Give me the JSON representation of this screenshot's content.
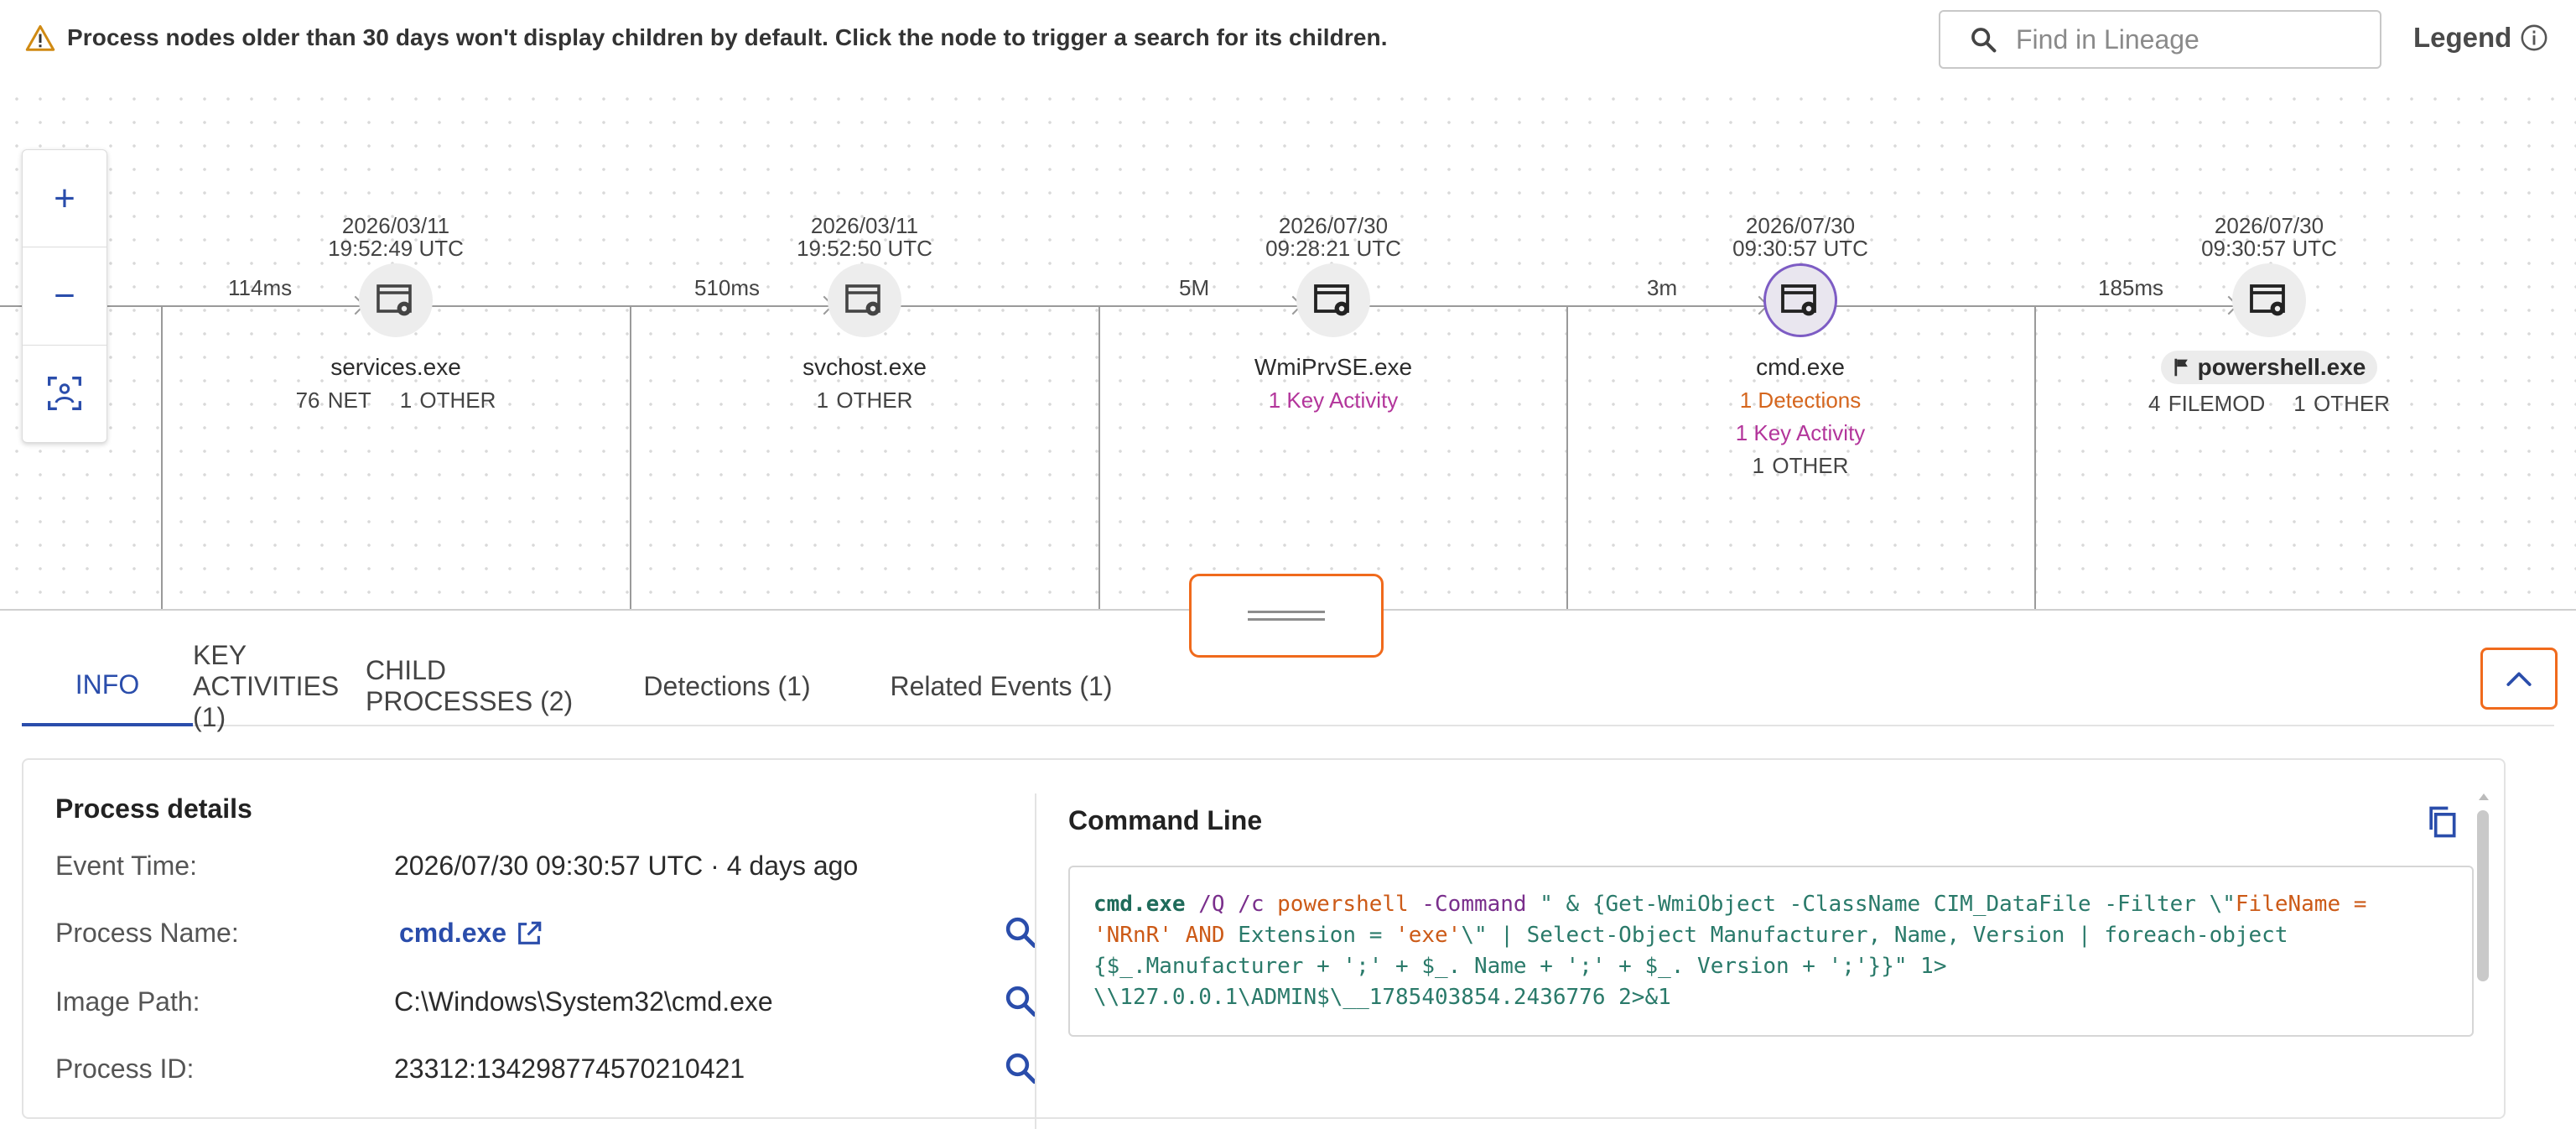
{
  "banner": {
    "text": "Process nodes older than 30 days won't display children by default. Click the node to trigger a search for its children."
  },
  "search": {
    "placeholder": "Find in Lineage"
  },
  "legend": {
    "label": "Legend"
  },
  "zoom": {
    "in": "+",
    "out": "−"
  },
  "durations": [
    "114ms",
    "510ms",
    "5M",
    "3m",
    "185ms"
  ],
  "nodes": [
    {
      "date": "2026/03/11",
      "time": "19:52:49 UTC",
      "name": "services.exe",
      "meta1": "76 NET",
      "meta2": "1 OTHER"
    },
    {
      "date": "2026/03/11",
      "time": "19:52:50 UTC",
      "name": "svchost.exe",
      "meta1": "1 OTHER"
    },
    {
      "date": "2026/07/30",
      "time": "09:28:21 UTC",
      "name": "WmiPrvSE.exe",
      "key": "1 Key Activity"
    },
    {
      "date": "2026/07/30",
      "time": "09:30:57 UTC",
      "name": "cmd.exe",
      "detections": "1 Detections",
      "key": "1 Key Activity",
      "meta1": "1 OTHER"
    },
    {
      "date": "2026/07/30",
      "time": "09:30:57 UTC",
      "name": "powershell.exe",
      "meta1": "4 FILEMOD",
      "meta2": "1 OTHER"
    }
  ],
  "tabs": [
    {
      "label": "INFO"
    },
    {
      "label": "KEY ACTIVITIES (1)"
    },
    {
      "label": "CHILD PROCESSES (2)"
    },
    {
      "label": "Detections (1)"
    },
    {
      "label": "Related Events (1)"
    }
  ],
  "details": {
    "title": "Process details",
    "rows": [
      {
        "key": "Event Time:",
        "value": "2026/07/30 09:30:57 UTC · 4 days ago"
      },
      {
        "key": "Process Name:",
        "value": "cmd.exe"
      },
      {
        "key": "Image Path:",
        "value": "C:\\Windows\\System32\\cmd.exe"
      },
      {
        "key": "Process ID:",
        "value": "23312:134298774570210421"
      }
    ]
  },
  "command_line": {
    "title": "Command Line",
    "l1a": "cmd.exe",
    "l1b": " /Q /c ",
    "l1c": "powershell",
    "l1d": " -Command ",
    "l1e": "\"",
    "l1f": " & {Get-WmiObject -ClassName CIM_DataFile -Filter \\\"",
    "l1g": "FileName =",
    "l2a": "'NRnR' ",
    "l2b": "AND",
    "l2c": " Extension = ",
    "l2d": "'exe'",
    "l2e": "\\\" | Select-Object Manufacturer, Name, Version | foreach-object",
    "l3": "{$_.Manufacturer + ';' + $_. Name + ';' + $_. Version + ';'}}\" 1>",
    "l4": "\\\\127.0.0.1\\ADMIN$\\__1785403854.2436776 2>&1"
  },
  "colors": {
    "accent": "#2a4dab",
    "highlight": "#f06a1c",
    "key_activity": "#b3359b",
    "detection": "#d5661e"
  }
}
